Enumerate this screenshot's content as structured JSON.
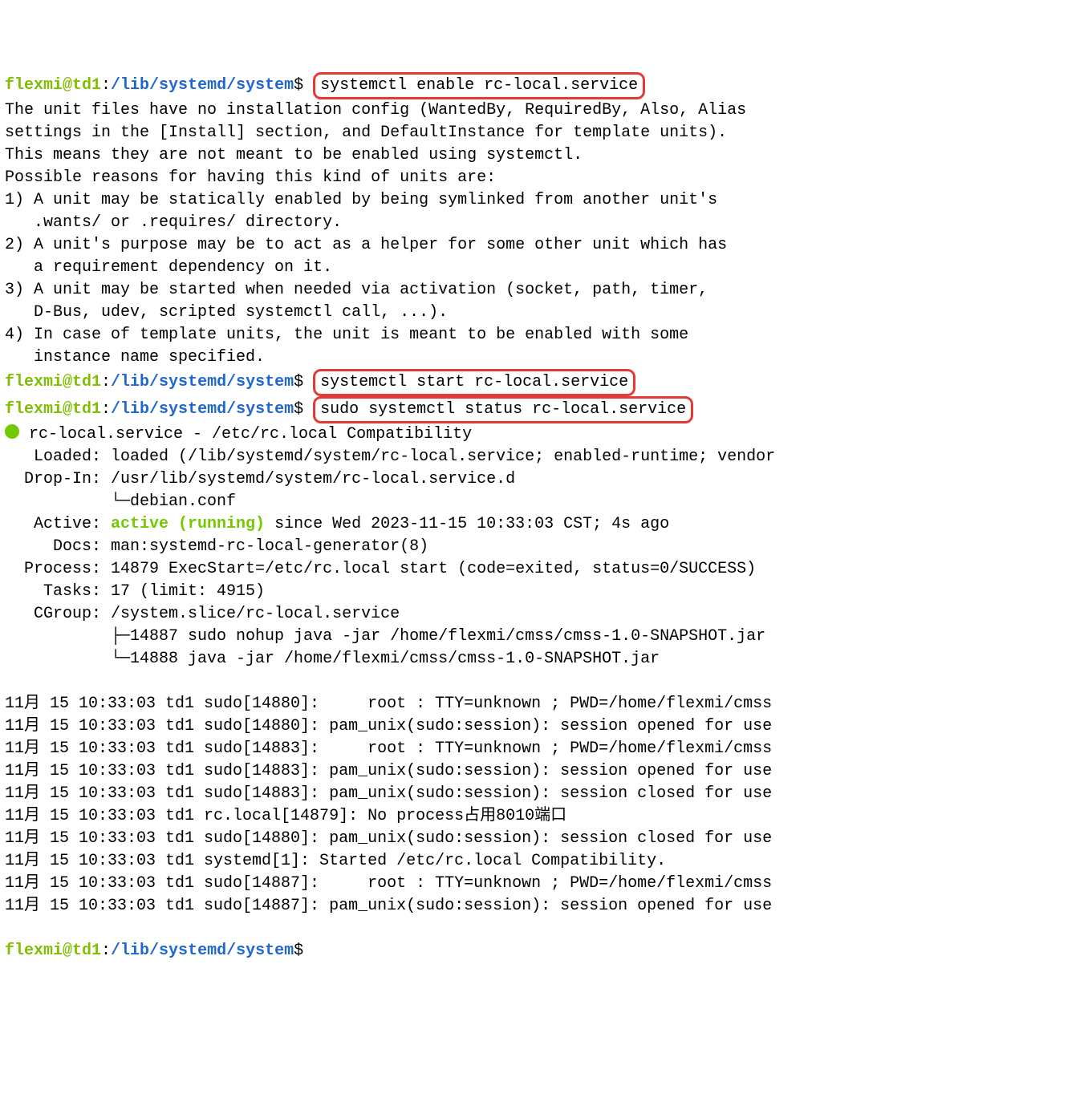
{
  "prompts": [
    {
      "user": "flexmi@td1",
      "path": "/lib/systemd/system",
      "command": "systemctl enable rc-local.service"
    },
    {
      "user": "flexmi@td1",
      "path": "/lib/systemd/system",
      "command": "systemctl start rc-local.service"
    },
    {
      "user": "flexmi@td1",
      "path": "/lib/systemd/system",
      "command": "sudo systemctl status rc-local.service"
    },
    {
      "user": "flexmi@td1",
      "path": "/lib/systemd/system",
      "command": ""
    }
  ],
  "output1": {
    "l0": "The unit files have no installation config (WantedBy, RequiredBy, Also, Alias",
    "l1": "settings in the [Install] section, and DefaultInstance for template units).",
    "l2": "This means they are not meant to be enabled using systemctl.",
    "l3": "Possible reasons for having this kind of units are:",
    "l4": "1) A unit may be statically enabled by being symlinked from another unit's",
    "l5": "   .wants/ or .requires/ directory.",
    "l6": "2) A unit's purpose may be to act as a helper for some other unit which has",
    "l7": "   a requirement dependency on it.",
    "l8": "3) A unit may be started when needed via activation (socket, path, timer,",
    "l9": "   D-Bus, udev, scripted systemctl call, ...).",
    "l10": "4) In case of template units, the unit is meant to be enabled with some",
    "l11": "   instance name specified."
  },
  "status": {
    "title": " rc-local.service - /etc/rc.local Compatibility",
    "loaded": "   Loaded: loaded (/lib/systemd/system/rc-local.service; enabled-runtime; vendor",
    "dropin": "  Drop-In: /usr/lib/systemd/system/rc-local.service.d",
    "dropin_file": "           └─debian.conf",
    "active_label": "   Active: ",
    "active_value": "active (running)",
    "active_since": " since Wed 2023-11-15 10:33:03 CST; 4s ago",
    "docs": "     Docs: man:systemd-rc-local-generator(8)",
    "process": "  Process: 14879 ExecStart=/etc/rc.local start (code=exited, status=0/SUCCESS)",
    "tasks": "    Tasks: 17 (limit: 4915)",
    "cgroup": "   CGroup: /system.slice/rc-local.service",
    "cgroup_l1": "           ├─14887 sudo nohup java -jar /home/flexmi/cmss/cmss-1.0-SNAPSHOT.jar",
    "cgroup_l2": "           └─14888 java -jar /home/flexmi/cmss/cmss-1.0-SNAPSHOT.jar"
  },
  "logs": [
    "11月 15 10:33:03 td1 sudo[14880]:     root : TTY=unknown ; PWD=/home/flexmi/cmss",
    "11月 15 10:33:03 td1 sudo[14880]: pam_unix(sudo:session): session opened for use",
    "11月 15 10:33:03 td1 sudo[14883]:     root : TTY=unknown ; PWD=/home/flexmi/cmss",
    "11月 15 10:33:03 td1 sudo[14883]: pam_unix(sudo:session): session opened for use",
    "11月 15 10:33:03 td1 sudo[14883]: pam_unix(sudo:session): session closed for use",
    "11月 15 10:33:03 td1 rc.local[14879]: No process占用8010端口",
    "11月 15 10:33:03 td1 sudo[14880]: pam_unix(sudo:session): session closed for use",
    "11月 15 10:33:03 td1 systemd[1]: Started /etc/rc.local Compatibility.",
    "11月 15 10:33:03 td1 sudo[14887]:     root : TTY=unknown ; PWD=/home/flexmi/cmss",
    "11月 15 10:33:03 td1 sudo[14887]: pam_unix(sudo:session): session opened for use"
  ]
}
